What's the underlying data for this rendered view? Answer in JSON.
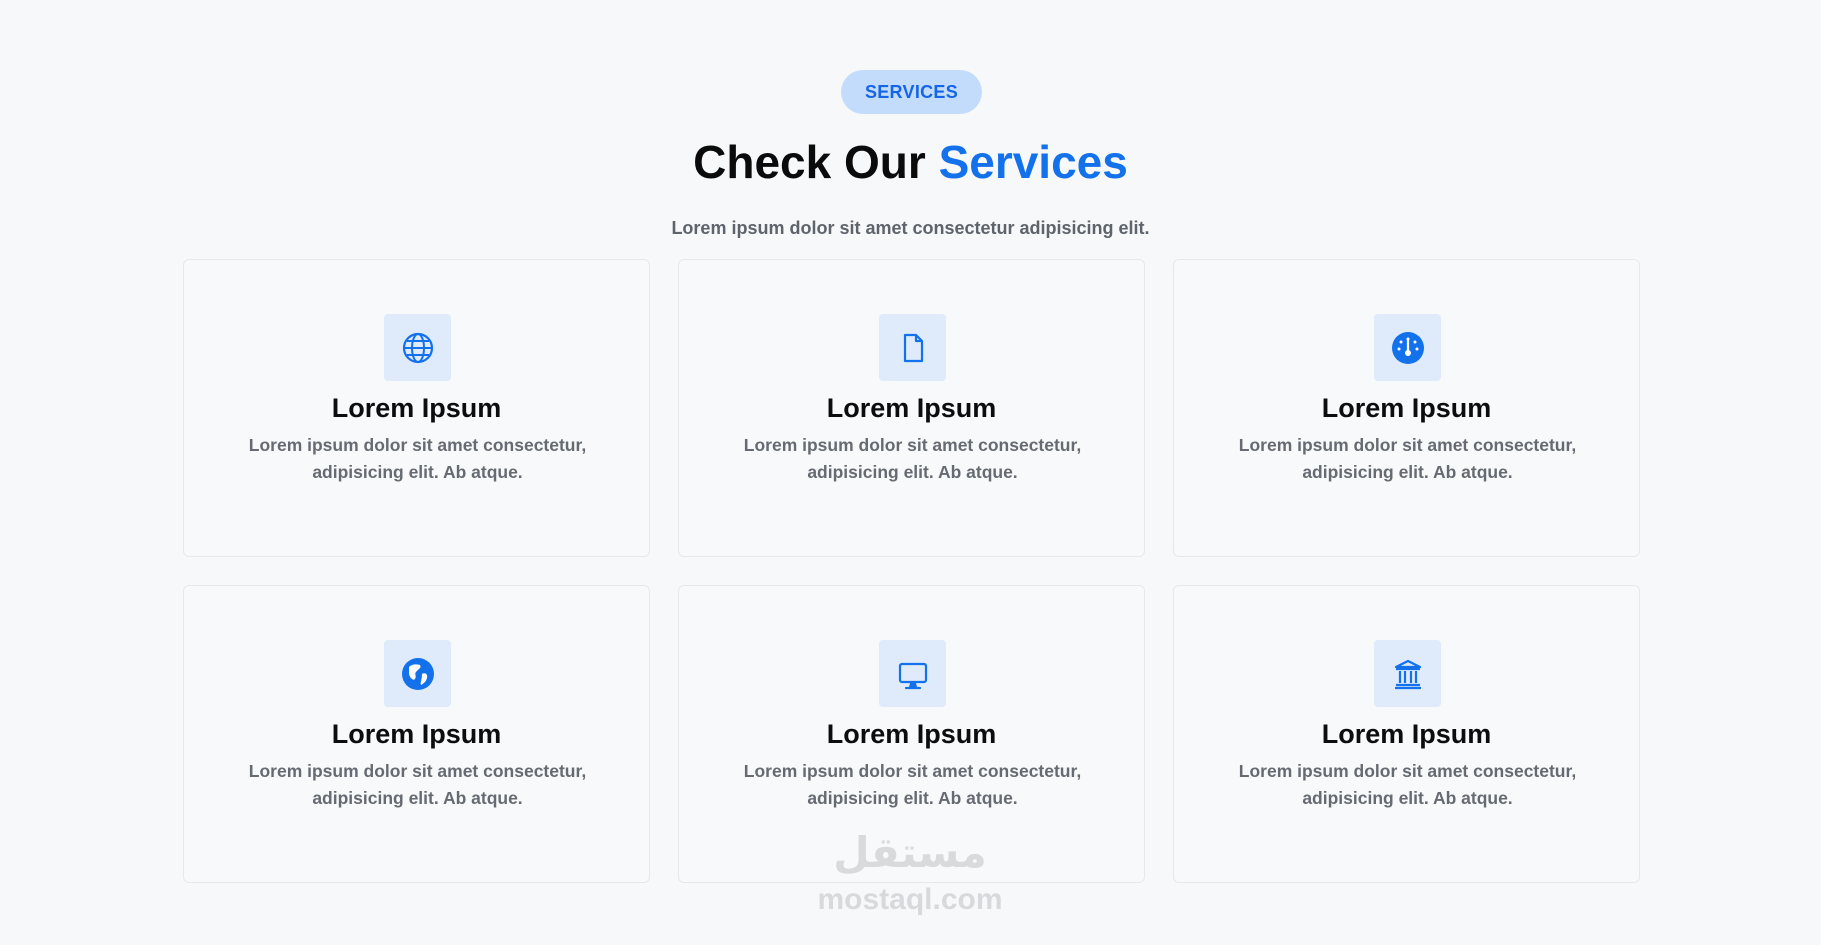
{
  "section": {
    "badge": "SERVICES",
    "heading_main": "Check Our ",
    "heading_accent": "Services",
    "subtitle": "Lorem ipsum dolor sit amet consectetur adipisicing elit."
  },
  "colors": {
    "accent": "#1371eb",
    "badge_bg": "#c4dcfb",
    "icon_bg": "#dfebfb",
    "page_bg": "#f7f8fa",
    "card_border": "#e6e8eb"
  },
  "cards": [
    {
      "icon": "globe-icon",
      "title": "Lorem Ipsum",
      "text": "Lorem ipsum dolor sit amet consectetur, adipisicing elit. Ab atque."
    },
    {
      "icon": "file-icon",
      "title": "Lorem Ipsum",
      "text": "Lorem ipsum dolor sit amet consectetur, adipisicing elit. Ab atque."
    },
    {
      "icon": "speedometer-icon",
      "title": "Lorem Ipsum",
      "text": "Lorem ipsum dolor sit amet consectetur, adipisicing elit. Ab atque."
    },
    {
      "icon": "globe-americas-icon",
      "title": "Lorem Ipsum",
      "text": "Lorem ipsum dolor sit amet consectetur, adipisicing elit. Ab atque."
    },
    {
      "icon": "monitor-icon",
      "title": "Lorem Ipsum",
      "text": "Lorem ipsum dolor sit amet consectetur, adipisicing elit. Ab atque."
    },
    {
      "icon": "bank-icon",
      "title": "Lorem Ipsum",
      "text": "Lorem ipsum dolor sit amet consectetur, adipisicing elit. Ab atque."
    }
  ],
  "watermark": {
    "arabic": "مستقل",
    "latin": "mostaql.com"
  }
}
